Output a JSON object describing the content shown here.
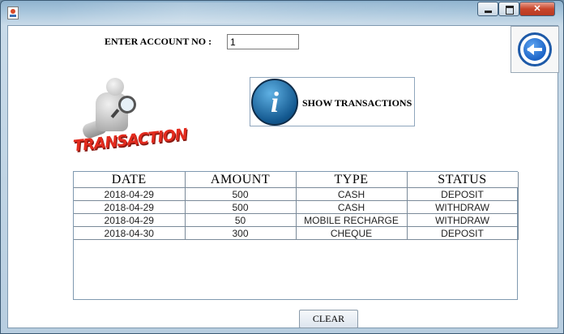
{
  "window": {
    "title": ""
  },
  "account": {
    "label": "ENTER ACCOUNT NO :",
    "value": "1"
  },
  "clipart": {
    "text": "TRANSACTION"
  },
  "show_button": {
    "label": "SHOW TRANSACTIONS",
    "icon": "info-icon"
  },
  "back_button": {
    "icon": "back-arrow-icon"
  },
  "table": {
    "headers": [
      "DATE",
      "AMOUNT",
      "TYPE",
      "STATUS"
    ],
    "rows": [
      [
        "2018-04-29",
        "500",
        "CASH",
        "DEPOSIT"
      ],
      [
        "2018-04-29",
        "500",
        "CASH",
        "WITHDRAW"
      ],
      [
        "2018-04-29",
        "50",
        "MOBILE RECHARGE",
        "WITHDRAW"
      ],
      [
        "2018-04-30",
        "300",
        "CHEQUE",
        "DEPOSIT"
      ]
    ]
  },
  "clear_button": {
    "label": "CLEAR"
  },
  "colors": {
    "accent": "#1b63c6",
    "clipart_red": "#e32b1e",
    "info_blue": "#13588f"
  }
}
